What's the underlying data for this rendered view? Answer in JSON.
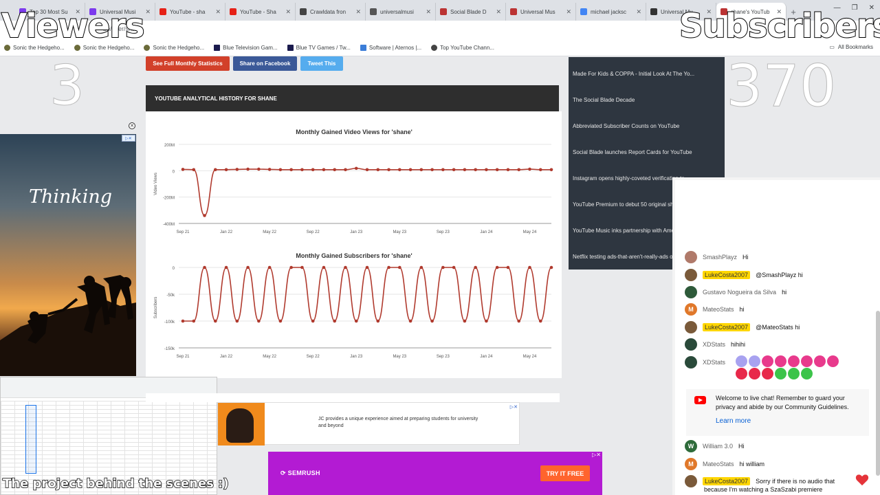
{
  "browser": {
    "tabs": [
      {
        "title": "Top 30 Most Su",
        "color": "#7c3aed"
      },
      {
        "title": "Universal Musi",
        "color": "#7c3aed"
      },
      {
        "title": "YouTube - sha",
        "color": "#e62117"
      },
      {
        "title": "YouTube - Sha",
        "color": "#e62117"
      },
      {
        "title": "Crawldata fron",
        "color": "#444444"
      },
      {
        "title": "universalmusi",
        "color": "#555555"
      },
      {
        "title": "Social Blade D",
        "color": "#b33"
      },
      {
        "title": "Universal Mus",
        "color": "#b33"
      },
      {
        "title": "michael jacksc",
        "color": "#4285f4"
      },
      {
        "title": "Universal Mu",
        "color": "#333"
      },
      {
        "title": "shane's YouTub",
        "color": "#b33"
      }
    ],
    "new_tab": "+",
    "url": "be/user/shane",
    "bookmarks": [
      {
        "label": "Sonic the Hedgeho...",
        "icon": "sonic-icon"
      },
      {
        "label": "Sonic the Hedgeho...",
        "icon": "sonic-icon"
      },
      {
        "label": "Sonic the Hedgeho...",
        "icon": "sonic-icon"
      },
      {
        "label": "Blue Television Gam...",
        "icon": "game-icon"
      },
      {
        "label": "Blue TV Games / Tw...",
        "icon": "game-icon"
      },
      {
        "label": "Software | Aternos |...",
        "icon": "software-icon"
      },
      {
        "label": "Top YouTube Chann...",
        "icon": "globe-icon"
      }
    ],
    "all_bookmarks": "All Bookmarks"
  },
  "overlay": {
    "viewers_label": "Viewers",
    "viewers_count": "3",
    "subscribers_label": "Subscribers",
    "subscribers_count": "370",
    "caption": "The project behind the scenes :)"
  },
  "page": {
    "buttons": {
      "monthly": "See Full Monthly Statistics",
      "facebook": "Share on Facebook",
      "tweet": "Tweet This"
    },
    "section_title": "YOUTUBE ANALYTICAL HISTORY FOR SHANE",
    "news": [
      "Made For Kids & COPPA - Initial Look At The Yo...",
      "The Social Blade Decade",
      "Abbreviated Subscriber Counts on YouTube",
      "Social Blade launches Report Cards for YouTube",
      "Instagram opens highly-coveted verification to...",
      "YouTube Premium to debut 50 original shows in ...",
      "YouTube Music inks partnership with American M...",
      "Netflix testing ads-that-aren't-really-ads on ..."
    ]
  },
  "chart_data": [
    {
      "type": "line",
      "title": "Monthly Gained Video Views for 'shane'",
      "ylabel": "Video Views",
      "xlabel": "",
      "x_ticks": [
        "Sep 21",
        "Jan 22",
        "May 22",
        "Sep 22",
        "Jan 23",
        "May 23",
        "Sep 23",
        "Jan 24",
        "May 24"
      ],
      "y_ticks": [
        "200M",
        "0",
        "-200M",
        "-400M"
      ],
      "ylim": [
        -400000000,
        200000000
      ],
      "grid": true,
      "color": "#b03a2e",
      "x": [
        "2021-09",
        "2021-10",
        "2021-11",
        "2021-12",
        "2022-01",
        "2022-02",
        "2022-03",
        "2022-04",
        "2022-05",
        "2022-06",
        "2022-07",
        "2022-08",
        "2022-09",
        "2022-10",
        "2022-11",
        "2022-12",
        "2023-01",
        "2023-02",
        "2023-03",
        "2023-04",
        "2023-05",
        "2023-06",
        "2023-07",
        "2023-08",
        "2023-09",
        "2023-10",
        "2023-11",
        "2023-12",
        "2024-01",
        "2024-02",
        "2024-03",
        "2024-04",
        "2024-05",
        "2024-06",
        "2024-07"
      ],
      "values": [
        10000000,
        8000000,
        -340000000,
        8000000,
        8000000,
        10000000,
        12000000,
        12000000,
        10000000,
        8000000,
        8000000,
        8000000,
        8000000,
        8000000,
        8000000,
        8000000,
        18000000,
        8000000,
        8000000,
        8000000,
        8000000,
        8000000,
        8000000,
        8000000,
        8000000,
        8000000,
        8000000,
        8000000,
        8000000,
        8000000,
        8000000,
        8000000,
        12000000,
        8000000,
        8000000
      ]
    },
    {
      "type": "line",
      "title": "Monthly Gained Subscribers for 'shane'",
      "ylabel": "Subscribers",
      "xlabel": "",
      "x_ticks": [
        "Sep 21",
        "Jan 22",
        "May 22",
        "Sep 22",
        "Jan 23",
        "May 23",
        "Sep 23",
        "Jan 24",
        "May 24"
      ],
      "y_ticks": [
        "0",
        "-50k",
        "-100k",
        "-150k"
      ],
      "ylim": [
        -150000,
        0
      ],
      "grid": true,
      "color": "#b03a2e",
      "x": [
        "2021-09",
        "2021-10",
        "2021-11",
        "2021-12",
        "2022-01",
        "2022-02",
        "2022-03",
        "2022-04",
        "2022-05",
        "2022-06",
        "2022-07",
        "2022-08",
        "2022-09",
        "2022-10",
        "2022-11",
        "2022-12",
        "2023-01",
        "2023-02",
        "2023-03",
        "2023-04",
        "2023-05",
        "2023-06",
        "2023-07",
        "2023-08",
        "2023-09",
        "2023-10",
        "2023-11",
        "2023-12",
        "2024-01",
        "2024-02",
        "2024-03",
        "2024-04",
        "2024-05",
        "2024-06",
        "2024-07"
      ],
      "values": [
        -100000,
        -100000,
        0,
        -100000,
        0,
        -100000,
        0,
        -100000,
        0,
        -100000,
        0,
        0,
        -100000,
        0,
        -100000,
        0,
        -100000,
        0,
        -100000,
        0,
        0,
        -100000,
        0,
        -100000,
        0,
        0,
        -100000,
        0,
        -100000,
        0,
        0,
        -100000,
        0,
        -100000,
        0
      ]
    }
  ],
  "ads": {
    "left_text": "Thinking",
    "mid_text": "JC provides a unique experience aimed at preparing students for university and beyond",
    "semrush_logo": "SEMRUSH",
    "semrush_cta": "TRY IT FREE"
  },
  "chat": {
    "messages": [
      {
        "author": "SmashPlayz",
        "message": "Hi",
        "highlight": false,
        "avatar_color": "#b07a6a",
        "initial": ""
      },
      {
        "author": "LukeCosta2007",
        "message": "@SmashPlayz hi",
        "highlight": true,
        "avatar_color": "#7a5a3a",
        "initial": ""
      },
      {
        "author": "Gustavo Nogueira da Silva",
        "message": "hi",
        "highlight": false,
        "avatar_color": "#2e5a3a",
        "initial": ""
      },
      {
        "author": "MateoStats",
        "message": "hi",
        "highlight": false,
        "avatar_color": "#e0782a",
        "initial": "M"
      },
      {
        "author": "LukeCosta2007",
        "message": "@MateoStats hi",
        "highlight": true,
        "avatar_color": "#7a5a3a",
        "initial": ""
      },
      {
        "author": "XDStats",
        "message": "hihihi",
        "highlight": false,
        "avatar_color": "#2a4a3a",
        "initial": ""
      },
      {
        "author": "XDStats",
        "message": "",
        "highlight": false,
        "avatar_color": "#2a4a3a",
        "initial": ""
      }
    ],
    "welcome_text": "Welcome to live chat! Remember to guard your privacy and abide by our Community Guidelines.",
    "learn_more": "Learn more",
    "later_messages": [
      {
        "author": "William 3.0",
        "message": "Hi",
        "highlight": false,
        "avatar_color": "#2e6b3a",
        "initial": "W"
      },
      {
        "author": "MateoStats",
        "message": "hi william",
        "highlight": false,
        "avatar_color": "#e0782a",
        "initial": "M"
      },
      {
        "author": "LukeCosta2007",
        "message": "Sorry if there is no audio that",
        "highlight": true,
        "avatar_color": "#7a5a3a",
        "initial": ""
      }
    ],
    "continuation": "because I'm watching a SzaSzabi premiere"
  }
}
